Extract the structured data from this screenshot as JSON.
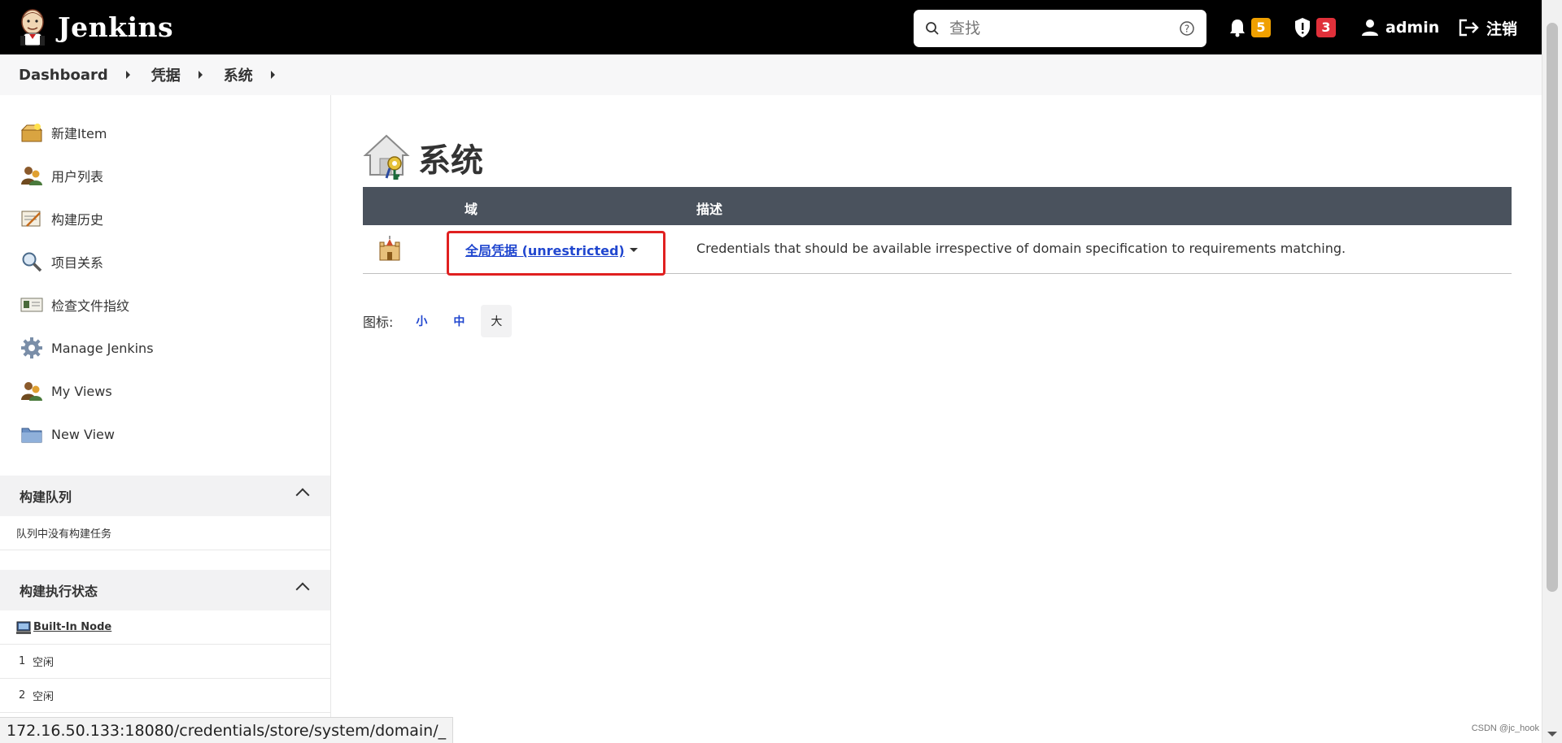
{
  "header": {
    "logo_text": "Jenkins",
    "search_placeholder": "查找",
    "notifications_count": "5",
    "security_count": "3",
    "user_name": "admin",
    "logout_label": "注销",
    "colors": {
      "bar": "#000000",
      "notification_badge": "#f0a000",
      "security_badge": "#e0303a"
    }
  },
  "breadcrumb": [
    "Dashboard",
    "凭据",
    "系统"
  ],
  "sidebar": {
    "tasks": [
      {
        "label": "新建Item",
        "icon": "new-item-icon"
      },
      {
        "label": "用户列表",
        "icon": "users-icon"
      },
      {
        "label": "构建历史",
        "icon": "build-history-icon"
      },
      {
        "label": "项目关系",
        "icon": "search-icon"
      },
      {
        "label": "检查文件指纹",
        "icon": "fingerprint-icon"
      },
      {
        "label": "Manage Jenkins",
        "icon": "gear-icon"
      },
      {
        "label": "My Views",
        "icon": "users-icon"
      },
      {
        "label": "New View",
        "icon": "folder-icon"
      }
    ],
    "build_queue": {
      "title": "构建队列",
      "empty_text": "队列中没有构建任务"
    },
    "executors": {
      "title": "构建执行状态",
      "node": "Built-In Node",
      "rows": [
        {
          "num": "1",
          "status": "空闲"
        },
        {
          "num": "2",
          "status": "空闲"
        }
      ]
    }
  },
  "main": {
    "title": "系统",
    "table": {
      "headers": {
        "domain": "域",
        "description": "描述"
      },
      "rows": [
        {
          "domain": "全局凭据 (unrestricted)",
          "description": "Credentials that should be available irrespective of domain specification to requirements matching."
        }
      ]
    },
    "icon_size": {
      "label": "图标:",
      "options": [
        "小",
        "中",
        "大"
      ],
      "selected": "大"
    }
  },
  "status_bar": {
    "url": "172.16.50.133:18080/credentials/store/system/domain/_"
  },
  "watermark": "CSDN @jc_hook"
}
